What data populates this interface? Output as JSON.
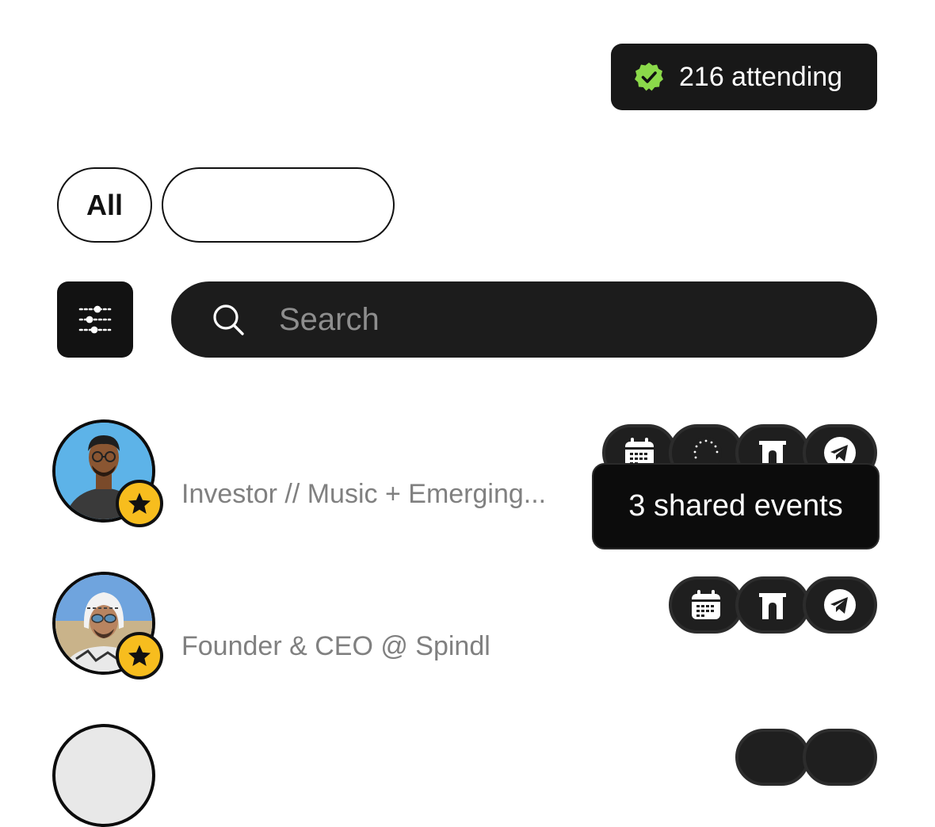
{
  "attending": {
    "count_label": "216 attending"
  },
  "filters": {
    "all_label": "All",
    "second_label": ""
  },
  "search": {
    "placeholder": "Search"
  },
  "attendees": [
    {
      "subtitle": "Investor // Music + Emerging...",
      "event_icons": [
        "calendar-icon",
        "circular-text-logo-icon",
        "arch-icon",
        "telegram-icon"
      ]
    },
    {
      "subtitle": "Founder & CEO @ Spindl",
      "event_icons": [
        "calendar-icon",
        "arch-icon",
        "telegram-icon"
      ]
    }
  ],
  "tooltip": {
    "text": "3 shared events"
  },
  "colors": {
    "background": "#ffffff",
    "dark": "#181818",
    "verified_green": "#8bd94a",
    "star_badge": "#f7bd1e",
    "subtitle_gray": "#808080"
  }
}
